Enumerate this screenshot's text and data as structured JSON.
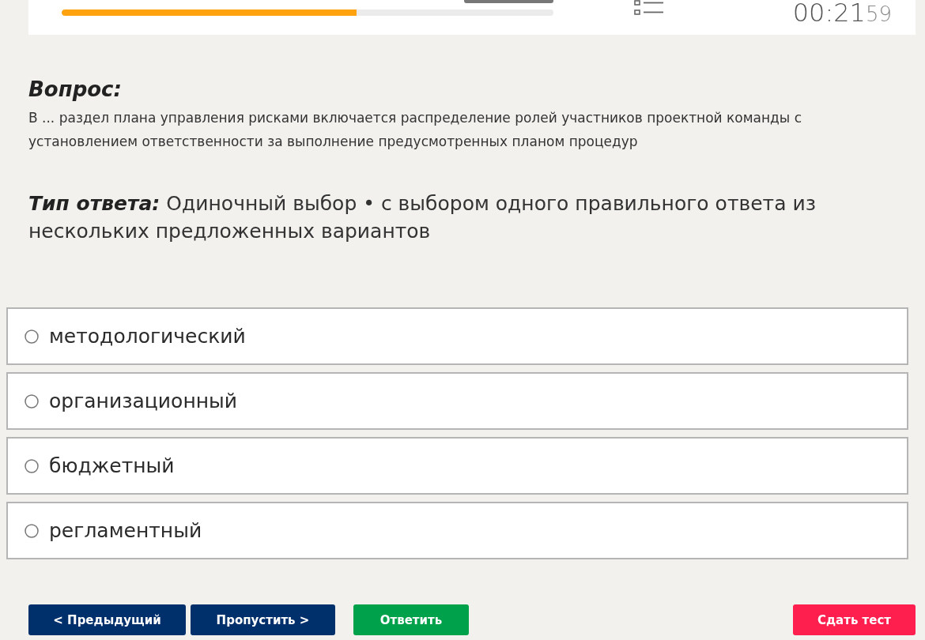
{
  "header": {
    "progress": {
      "level": 0.6
    },
    "timer": {
      "main": "00:21",
      "seconds": "59"
    }
  },
  "question": {
    "heading": "Вопрос:",
    "text": "В ... раздел плана управления рисками включается распределение ролей участников проектной команды с установлением ответственности за выполнение предусмотренных планом процедур"
  },
  "answer_type": {
    "label": "Тип ответа:",
    "text": "Одиночный выбор • с выбором одного правильного ответа из нескольких предложенных вариантов"
  },
  "options": [
    {
      "label": "методологический",
      "selected": false
    },
    {
      "label": "организационный",
      "selected": false
    },
    {
      "label": "бюджетный",
      "selected": false
    },
    {
      "label": "регламентный",
      "selected": false
    }
  ],
  "buttons": [
    {
      "label": "< Предыдущий",
      "kind": "nav"
    },
    {
      "label": "Пропустить >",
      "kind": "nav"
    },
    {
      "label": "Ответить",
      "kind": "confirm"
    },
    {
      "label": "Сдать тест",
      "kind": "finish"
    }
  ]
}
